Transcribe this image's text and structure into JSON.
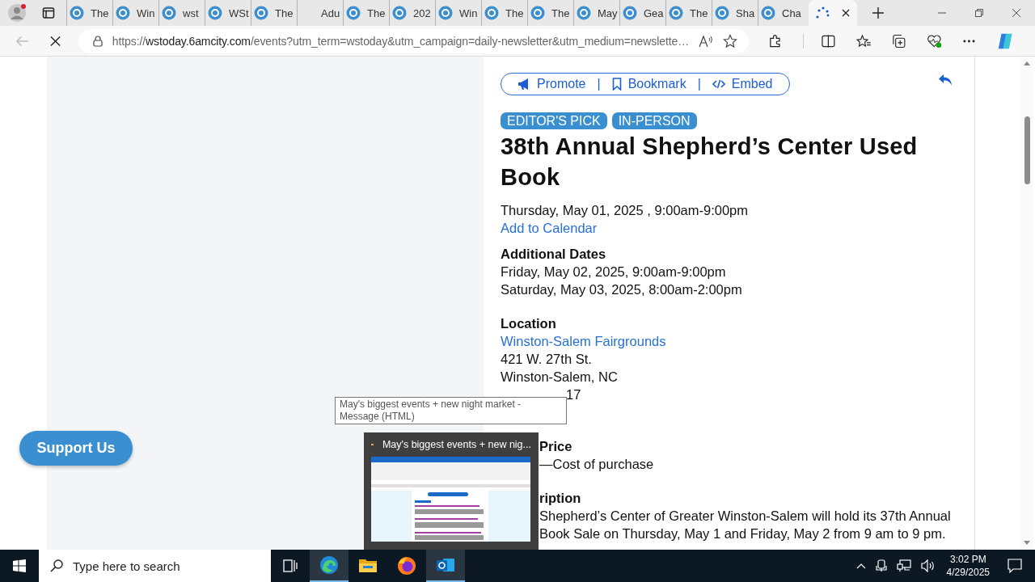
{
  "browser": {
    "tabs": [
      {
        "title": "The",
        "kind": "site",
        "selected": false
      },
      {
        "title": "Win",
        "kind": "site",
        "selected": false
      },
      {
        "title": "wst",
        "kind": "site",
        "selected": false
      },
      {
        "title": "WSt",
        "kind": "site",
        "selected": false
      },
      {
        "title": "The",
        "kind": "site",
        "selected": false
      },
      {
        "title": "Adu",
        "kind": "blank",
        "selected": false
      },
      {
        "title": "The",
        "kind": "site",
        "selected": false
      },
      {
        "title": "202",
        "kind": "site",
        "selected": false
      },
      {
        "title": "Win",
        "kind": "site",
        "selected": false
      },
      {
        "title": "The",
        "kind": "site",
        "selected": false
      },
      {
        "title": "The",
        "kind": "site",
        "selected": false
      },
      {
        "title": "May",
        "kind": "site",
        "selected": false
      },
      {
        "title": "Gea",
        "kind": "site",
        "selected": false
      },
      {
        "title": "The",
        "kind": "site",
        "selected": false
      },
      {
        "title": "Sha",
        "kind": "site",
        "selected": false
      },
      {
        "title": "Cha",
        "kind": "site",
        "selected": false
      },
      {
        "kind": "loading",
        "selected": true
      }
    ],
    "address": {
      "scheme": "https://",
      "host": "wstoday.6amcity.com",
      "path": "/events?utm_term=wstoday&utm_campaign=daily-newsletter&utm_medium=newslette…"
    }
  },
  "event": {
    "actions": [
      "Promote",
      "Bookmark",
      "Embed"
    ],
    "action_separator": "|",
    "tags": [
      "EDITOR'S PICK",
      "IN-PERSON"
    ],
    "title": "38th Annual Shepherd’s Center Used Book",
    "date": "Thursday, May 01, 2025 , 9:00am-9:00pm",
    "calendar_link": "Add to Calendar",
    "additional_dates_heading": "Additional Dates",
    "additional_dates": [
      "Friday, May 02, 2025, 9:00am-9:00pm",
      "Saturday, May 03, 2025, 8:00am-2:00pm"
    ],
    "location_heading": "Location",
    "venue_link": "Winston-Salem Fairgrounds",
    "address_lines": [
      "421 W. 27th St.",
      "Winston-Salem, NC"
    ],
    "zip_visible": "17",
    "price_heading": "Price",
    "price_visible": "—Cost of purchase",
    "description_heading_visible": "ription",
    "description_lines_visible": [
      "Shepherd’s Center of Greater Winston-Salem will hold its 37th Annual",
      "Book Sale on Thursday, May 1 and Friday, May 2 from 9 am to 9 pm."
    ]
  },
  "support_button": "Support Us",
  "tooltip": "May's biggest events + new night market - Message (HTML)",
  "preview": {
    "title": "May's biggest events + new nig..."
  },
  "taskbar": {
    "search_placeholder": "Type here to search",
    "apps": [
      {
        "kind": "taskview",
        "selected": false
      },
      {
        "kind": "edge",
        "selected": true
      },
      {
        "kind": "explorer",
        "selected": false
      },
      {
        "kind": "firefox",
        "selected": false
      },
      {
        "kind": "outlook",
        "selected": true
      }
    ],
    "time": "3:02 PM",
    "date": "4/29/2025"
  }
}
